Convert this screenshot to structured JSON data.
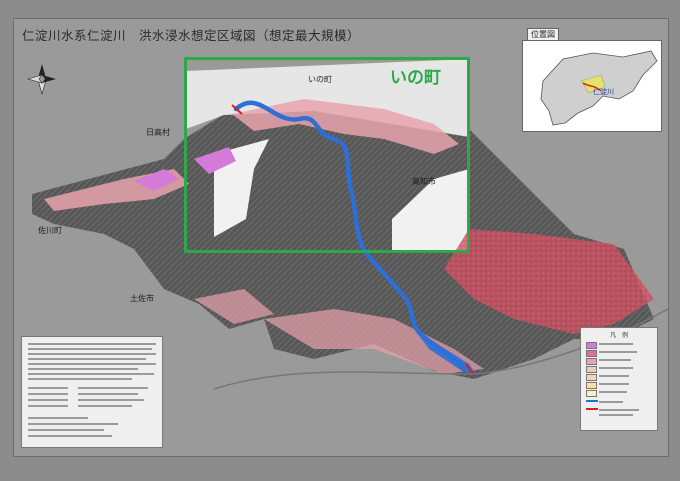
{
  "title": "仁淀川水系仁淀川　洪水浸水想定区域図（想定最大規模）",
  "highlight": {
    "label": "いの町"
  },
  "location_map": {
    "title": "位置図",
    "river_label": "仁淀川"
  },
  "place_labels": {
    "ino_town": "いの町",
    "hidaka_village": "日高村",
    "kochi_city": "高知市",
    "sakawa_town": "佐川町",
    "tosa_city": "土佐市"
  },
  "colors": {
    "highlight_border": "#2fa84a",
    "river": "#2d6fd6",
    "flood_light": "#e8a3ac",
    "flood_mid": "#d9566a",
    "flood_deep": "#d47ad8",
    "land_dark": "#5d5d5d",
    "land_light": "#f1f1f1"
  },
  "legend": {
    "title": "凡　例",
    "swatches": [
      {
        "color": "#d47ad8"
      },
      {
        "color": "#e46aa0"
      },
      {
        "color": "#e8a3ac"
      },
      {
        "color": "#f0c8c8"
      },
      {
        "color": "#f3d7b6"
      },
      {
        "color": "#f6e39c"
      },
      {
        "color": "#f6f2c6"
      }
    ]
  }
}
